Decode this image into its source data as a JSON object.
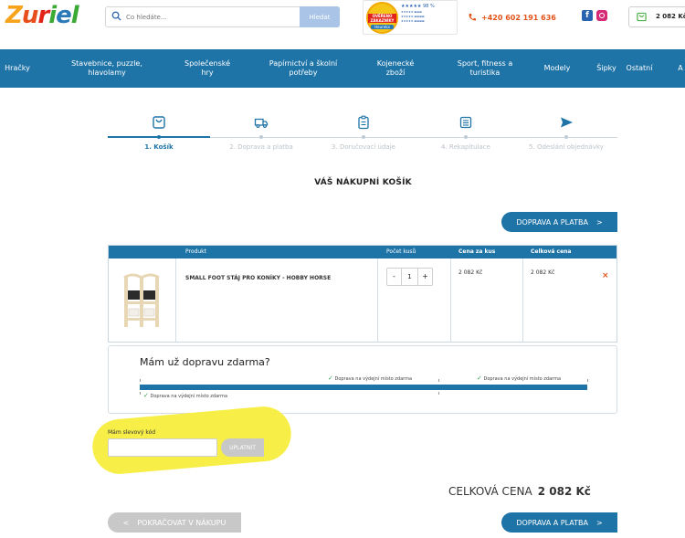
{
  "header": {
    "logo_letters": [
      {
        "ch": "Z",
        "color": "#f7a31c"
      },
      {
        "ch": "u",
        "color": "#e84e1b"
      },
      {
        "ch": "r",
        "color": "#e2231a"
      },
      {
        "ch": "i",
        "color": "#3aaa35"
      },
      {
        "ch": "e",
        "color": "#2a7ab8"
      },
      {
        "ch": "l",
        "color": "#3aaa35"
      }
    ],
    "search_placeholder": "Co hledáte...",
    "search_button": "Hledat",
    "badge": {
      "seal_top": "OVĚŘENO",
      "seal_mid": "ZÁKAZNÍKY",
      "seal_brand": "Heureka",
      "rating": "★★★★★ 98 %"
    },
    "phone": "+420 602 191 636",
    "cart_total": "2 082 Kč"
  },
  "nav": [
    {
      "label": "Hračky"
    },
    {
      "label": "Stavebnice, puzzle, hlavolamy"
    },
    {
      "label": "Společenské hry"
    },
    {
      "label": "Papírnictví a školní potřeby"
    },
    {
      "label": "Kojenecké zboží"
    },
    {
      "label": "Sport, fitness a turistika"
    },
    {
      "label": "Modely"
    },
    {
      "label": "Šipky"
    },
    {
      "label": "Ostatní"
    },
    {
      "label": "A"
    }
  ],
  "steps": [
    {
      "label": "1. Košík",
      "icon": "cart-icon",
      "active": true
    },
    {
      "label": "2. Doprava a platba",
      "icon": "truck-icon",
      "active": false
    },
    {
      "label": "3. Doručovací údaje",
      "icon": "clipboard-icon",
      "active": false
    },
    {
      "label": "4. Rekapitulace",
      "icon": "list-icon",
      "active": false
    },
    {
      "label": "5. Odeslání objednávky",
      "icon": "send-icon",
      "active": false
    }
  ],
  "cart": {
    "title": "VÁŠ NÁKUPNÍ KOŠÍK",
    "next_button": "DOPRAVA A PLATBA",
    "columns": {
      "product": "Produkt",
      "quantity": "Počet kusů",
      "unit_price": "Cena za kus",
      "total_price": "Celková cena"
    },
    "items": [
      {
        "name": "SMALL FOOT STÁJ PRO KONÍKY - HOBBY HORSE",
        "quantity": "1",
        "unit_price": "2 082 Kč",
        "total_price": "2 082 Kč"
      }
    ]
  },
  "shipping": {
    "title": "Mám už dopravu zdarma?",
    "labels": [
      "Doprava na výdejní místo zdarma",
      "Doprava na výdejní místo zdarma",
      "Doprava na výdejní místo zdarma"
    ]
  },
  "coupon": {
    "label": "Mám slevový kód",
    "button": "UPLATNIT"
  },
  "summary": {
    "label": "CELKOVÁ CENA",
    "value": "2 082 Kč"
  },
  "back_button": "POKRAČOVAT V NÁKUPU",
  "colors": {
    "brand_blue": "#1e73a7",
    "remove": "#e2531a",
    "highlight": "#f7ee3d"
  }
}
